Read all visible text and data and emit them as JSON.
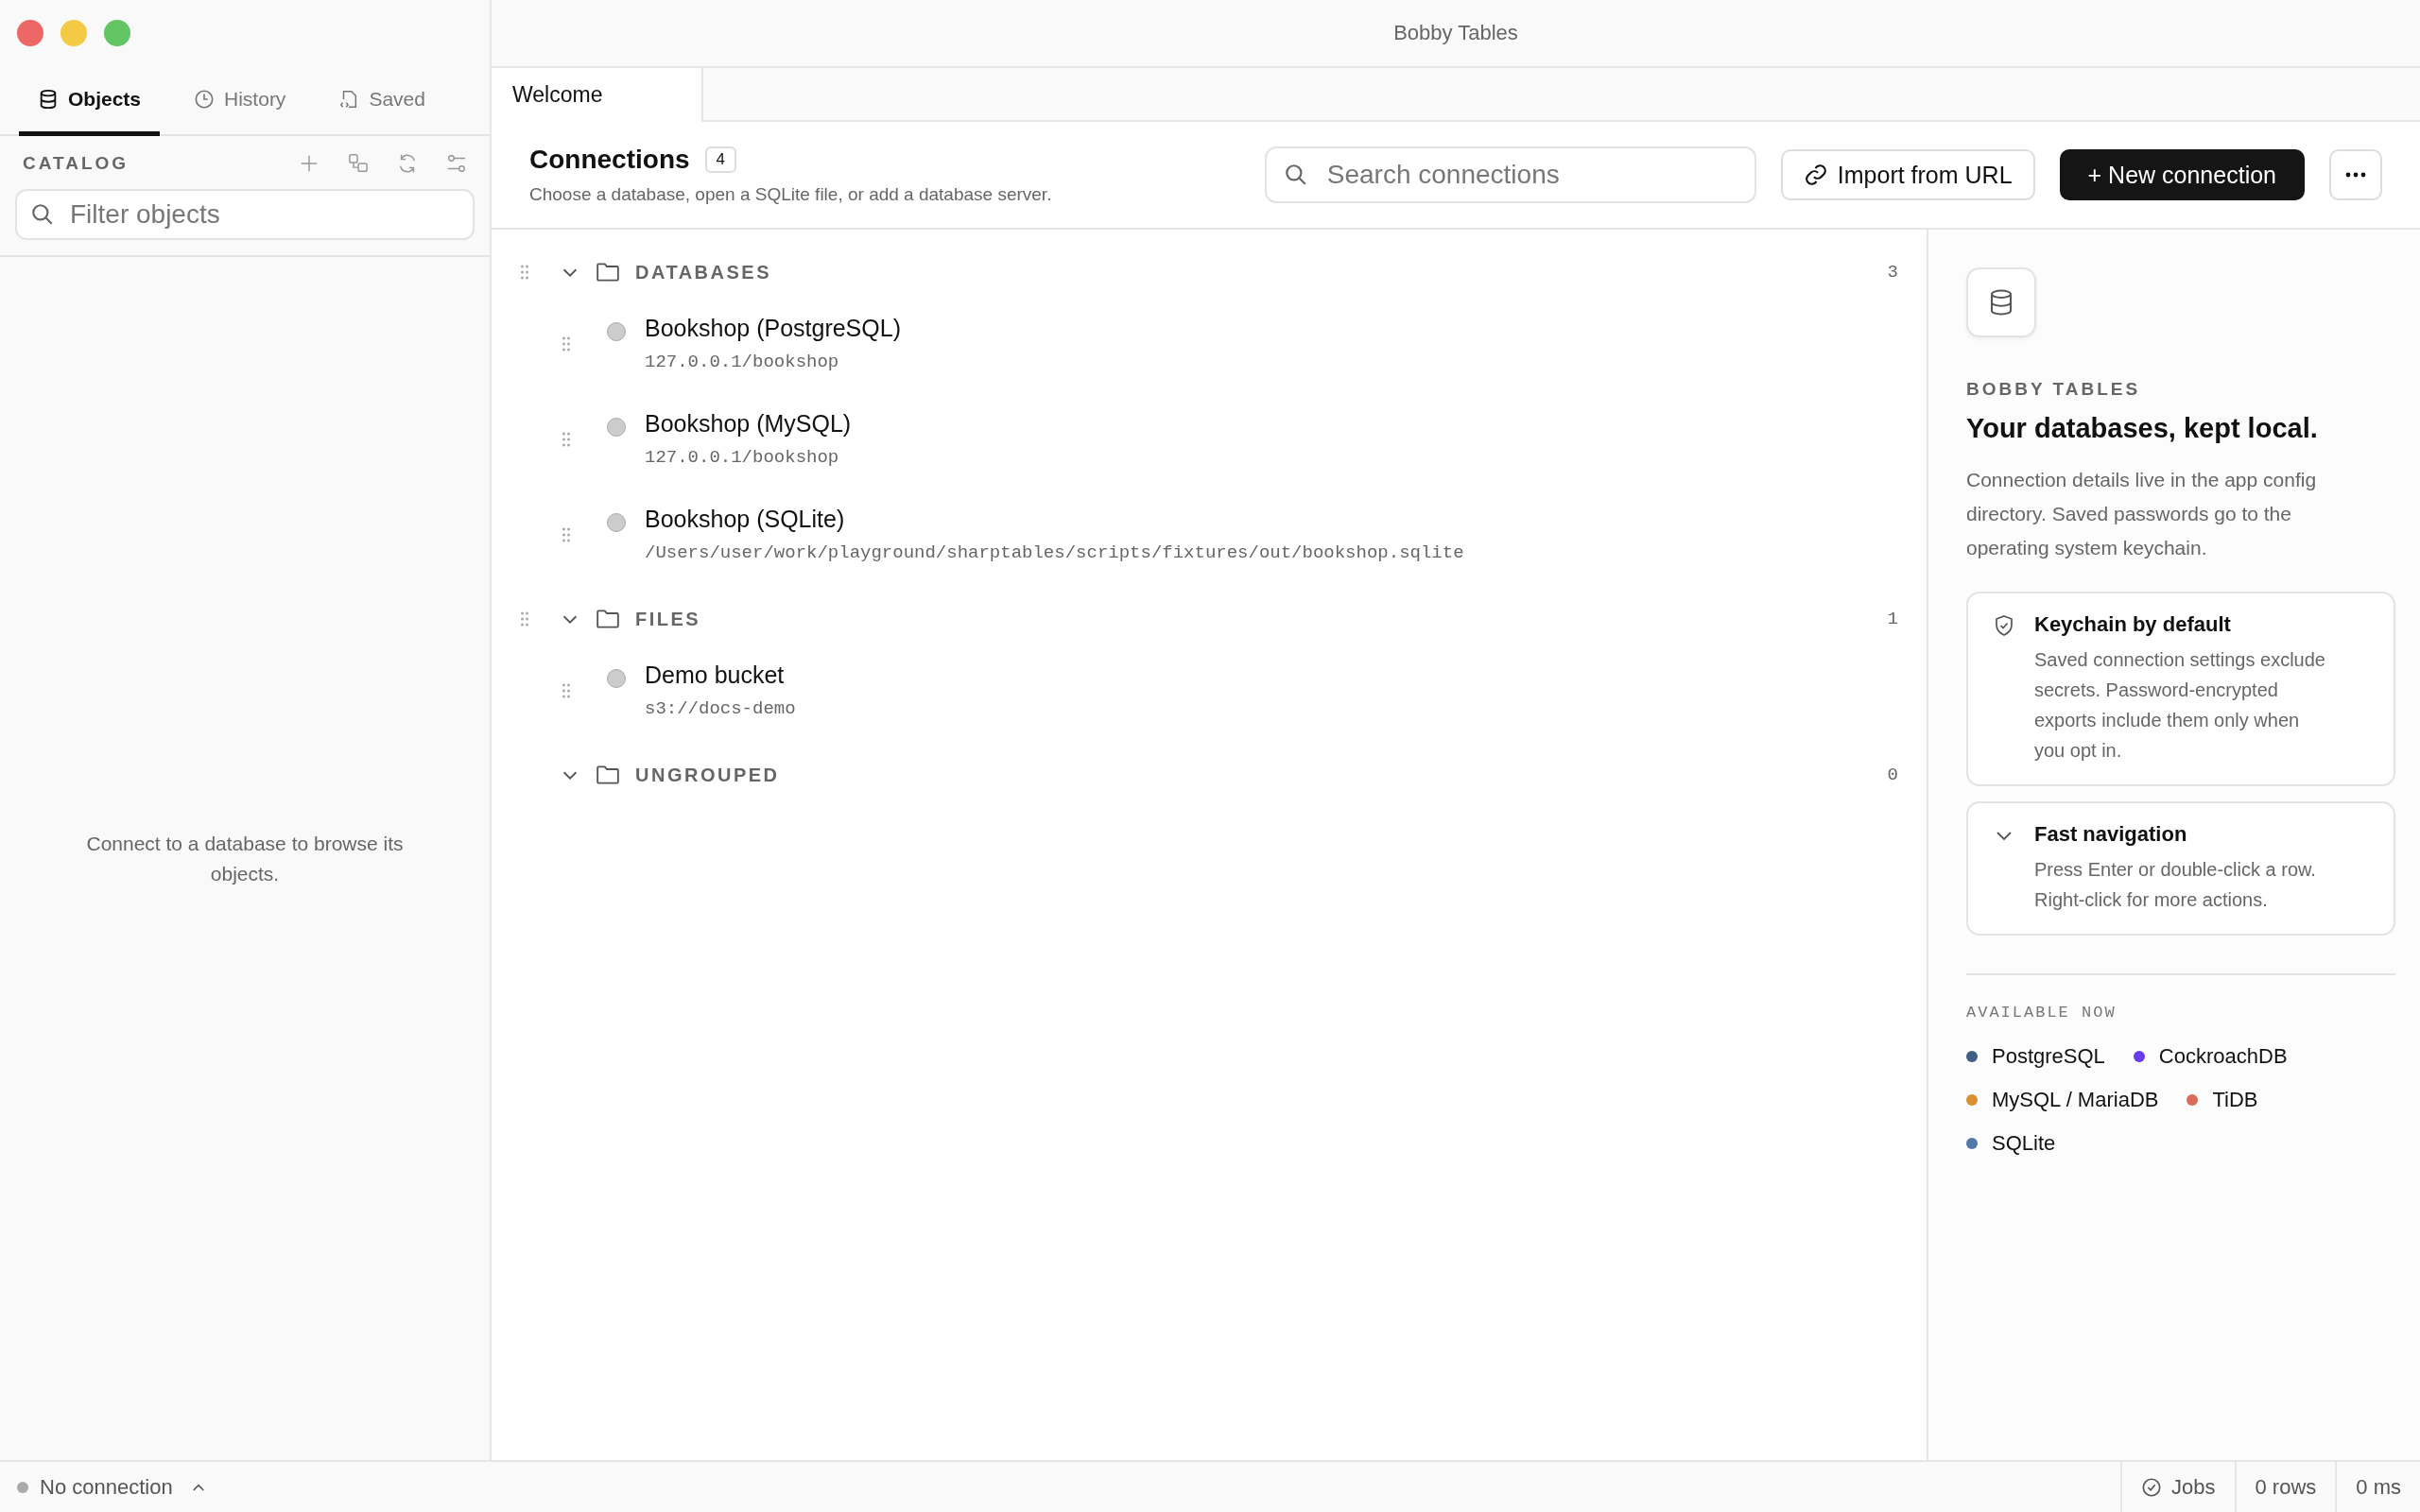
{
  "window": {
    "title": "Bobby Tables"
  },
  "sidebar": {
    "tabs": [
      {
        "label": "Objects",
        "kind": "database",
        "selected": true
      },
      {
        "label": "History",
        "kind": "history",
        "selected": false
      },
      {
        "label": "Saved",
        "kind": "saved",
        "selected": false
      }
    ],
    "catalog_label": "CATALOG",
    "filter": {
      "placeholder": "Filter objects"
    },
    "empty_message": "Connect to a database to browse its objects."
  },
  "editor_tabs": [
    {
      "label": "Welcome",
      "selected": true
    }
  ],
  "header": {
    "title": "Connections",
    "count": "4",
    "subtitle": "Choose a database, open a SQLite file, or add a database server.",
    "search": {
      "placeholder": "Search connections"
    },
    "import_button": "Import from URL",
    "new_button": "+ New connection"
  },
  "groups": [
    {
      "name": "DATABASES",
      "count": "3",
      "expanded": true,
      "draggable": true,
      "items": [
        {
          "name": "Bookshop (PostgreSQL)",
          "address": "127.0.0.1/bookshop",
          "connected": false
        },
        {
          "name": "Bookshop (MySQL)",
          "address": "127.0.0.1/bookshop",
          "connected": false
        },
        {
          "name": "Bookshop (SQLite)",
          "address": "/Users/user/work/playground/sharptables/scripts/fixtures/out/bookshop.sqlite",
          "connected": false
        }
      ]
    },
    {
      "name": "FILES",
      "count": "1",
      "expanded": true,
      "draggable": true,
      "items": [
        {
          "name": "Demo bucket",
          "address": "s3://docs-demo",
          "connected": false
        }
      ]
    },
    {
      "name": "UNGROUPED",
      "count": "0",
      "expanded": true,
      "draggable": false
    }
  ],
  "info_panel": {
    "eyebrow": "BOBBY TABLES",
    "heading": "Your databases, kept local.",
    "description": "Connection details live in the app config directory. Saved passwords go to the operating system keychain.",
    "cards": [
      {
        "kind": "shield",
        "title": "Keychain by default",
        "text": "Saved connection settings exclude secrets. Password-encrypted exports include them only when you opt in."
      },
      {
        "kind": "chevron",
        "title": "Fast navigation",
        "text": "Press Enter or double-click a row. Right-click for more actions."
      }
    ],
    "available_label": "AVAILABLE NOW",
    "engines": [
      {
        "name": "PostgreSQL",
        "color": "#3f5f87"
      },
      {
        "name": "CockroachDB",
        "color": "#6a3cf0"
      },
      {
        "name": "MySQL / MariaDB",
        "color": "#d9912f"
      },
      {
        "name": "TiDB",
        "color": "#de6a5a"
      },
      {
        "name": "SQLite",
        "color": "#5178a8"
      }
    ]
  },
  "status_bar": {
    "connection": "No connection",
    "jobs": "Jobs",
    "rows": "0 rows",
    "time": "0 ms"
  }
}
